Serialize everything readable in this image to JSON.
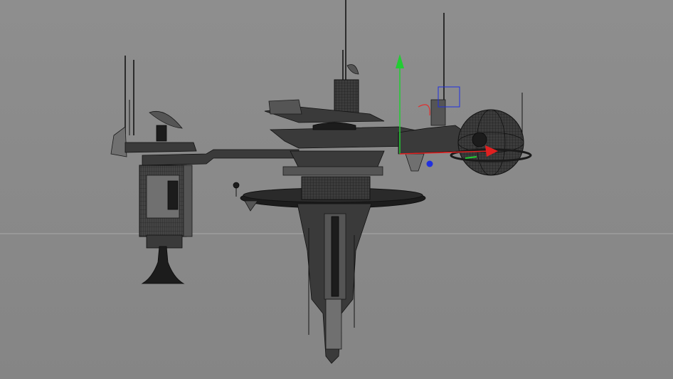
{
  "viewport": {
    "background_color": "#8a8a8a",
    "horizon_color": "#a8a8a8"
  },
  "model": {
    "wire_color": "#111111",
    "fill_color": "#3a3a3a"
  },
  "gizmo": {
    "y_axis_color": "#22cc33",
    "x_axis_color": "#e02020",
    "z_axis_color": "#2030e0",
    "rotate_ring_color": "#e03030"
  }
}
